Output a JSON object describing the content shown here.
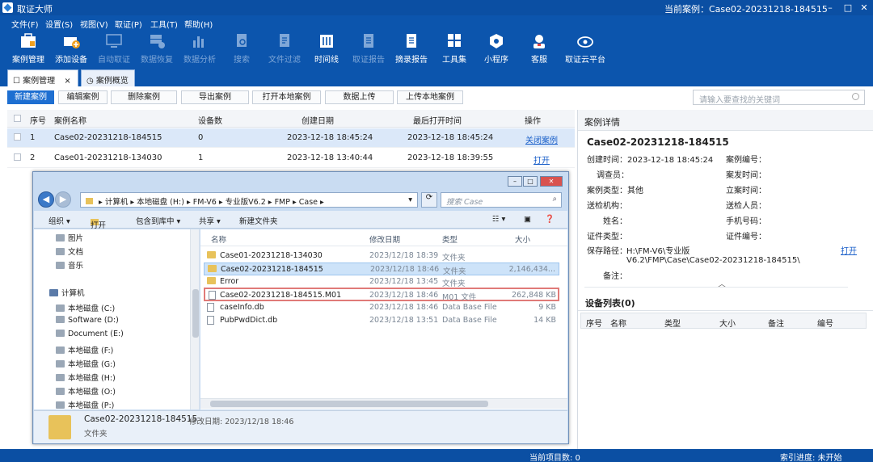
{
  "app": {
    "title": "取证大师",
    "current_case": "当前案例：Case02-20231218-184515"
  },
  "window_buttons": [
    "–",
    "□",
    "✕"
  ],
  "menu": [
    "文件(F)",
    "设置(S)",
    "视图(V)",
    "取证(P)",
    "工具(T)",
    "帮助(H)"
  ],
  "toolbar": [
    {
      "label": "案例管理",
      "icon": "case-manage-icon",
      "enabled": true
    },
    {
      "label": "添加设备",
      "icon": "add-device-icon",
      "enabled": true
    },
    {
      "label": "自动取证",
      "icon": "auto-forensics-icon",
      "enabled": false
    },
    {
      "label": "数据恢复",
      "icon": "data-recovery-icon",
      "enabled": false
    },
    {
      "label": "数据分析",
      "icon": "data-analysis-icon",
      "enabled": false
    },
    {
      "label": "搜索",
      "icon": "search-icon",
      "enabled": false
    },
    {
      "label": "文件过滤",
      "icon": "file-filter-icon",
      "enabled": false
    },
    {
      "label": "时间线",
      "icon": "timeline-icon",
      "enabled": true
    },
    {
      "label": "取证报告",
      "icon": "report-icon",
      "enabled": false
    },
    {
      "label": "摘录报告",
      "icon": "excerpt-report-icon",
      "enabled": true
    },
    {
      "label": "工具集",
      "icon": "toolset-icon",
      "enabled": true
    },
    {
      "label": "小程序",
      "icon": "miniprogram-icon",
      "enabled": true
    },
    {
      "label": "客服",
      "icon": "customer-service-icon",
      "enabled": true
    },
    {
      "label": "取证云平台",
      "icon": "cloud-platform-icon",
      "enabled": true
    }
  ],
  "tabs": [
    {
      "label": "案例管理",
      "close": "×"
    },
    {
      "label": "案例概览"
    }
  ],
  "actions": [
    "新建案例",
    "编辑案例",
    "删除案例",
    "导出案例",
    "打开本地案例",
    "数据上传",
    "上传本地案例"
  ],
  "search": {
    "placeholder": "请输入要查找的关键词"
  },
  "case_table": {
    "headers": [
      "序号",
      "案例名称",
      "设备数",
      "创建日期",
      "最后打开时间",
      "操作"
    ],
    "rows": [
      {
        "no": "1",
        "name": "Case02-20231218-184515",
        "devices": "0",
        "created": "2023-12-18 18:45:24",
        "opened": "2023-12-18 18:45:24",
        "op": "关闭案例"
      },
      {
        "no": "2",
        "name": "Case01-20231218-134030",
        "devices": "1",
        "created": "2023-12-18 13:40:44",
        "opened": "2023-12-18 18:39:55",
        "op": "打开"
      }
    ]
  },
  "detail": {
    "header": "案例详情",
    "case_name": "Case02-20231218-184515",
    "created": "创建时间：2023-12-18 18:45:24",
    "case_no": "案例编号：",
    "investigator": "调查员：",
    "incident_time": "案发时间：",
    "case_type": "案例类型：其他",
    "filing_time": "立案时间：",
    "submit_org": "送检机构：",
    "submitter": "送检人员：",
    "name": "姓名：",
    "phone": "手机号码：",
    "id_type": "证件类型：",
    "id_no": "证件编号：",
    "path_label": "保存路径：",
    "path_value1": "H:\\FM-V6\\专业版",
    "path_value2": "V6.2\\FMP\\Case\\Case02-20231218-184515\\",
    "open_link": "打开",
    "remark": "备注：",
    "collapse": "︿",
    "device_list": "设备列表(0)",
    "device_headers": [
      "序号",
      "名称",
      "类型",
      "大小",
      "备注",
      "编号"
    ]
  },
  "status": {
    "items": "当前项目数: 0",
    "index": "索引进度: 未开始"
  },
  "explorer": {
    "breadcrumb": [
      "计算机",
      "本地磁盘 (H:)",
      "FM-V6",
      "专业版V6.2",
      "FMP",
      "Case"
    ],
    "search_placeholder": "搜索 Case",
    "commands": [
      "组织 ▾",
      "打开",
      "包含到库中 ▾",
      "共享 ▾",
      "新建文件夹"
    ],
    "nav_items": [
      {
        "label": "图片",
        "icon": "pictures-icon"
      },
      {
        "label": "文档",
        "icon": "documents-icon"
      },
      {
        "label": "音乐",
        "icon": "music-icon"
      },
      {
        "label": "计算机",
        "icon": "computer-icon"
      },
      {
        "label": "本地磁盘 (C:)",
        "icon": "drive-icon"
      },
      {
        "label": "Software (D:)",
        "icon": "drive-icon"
      },
      {
        "label": "Document (E:)",
        "icon": "drive-icon"
      },
      {
        "label": "本地磁盘 (F:)",
        "icon": "drive-icon"
      },
      {
        "label": "本地磁盘 (G:)",
        "icon": "drive-icon"
      },
      {
        "label": "本地磁盘 (H:)",
        "icon": "drive-icon"
      },
      {
        "label": "本地磁盘 (O:)",
        "icon": "drive-icon"
      },
      {
        "label": "本地磁盘 (P:)",
        "icon": "drive-icon"
      }
    ],
    "file_headers": [
      "名称",
      "修改日期",
      "类型",
      "大小"
    ],
    "files": [
      {
        "name": "Case01-20231218-134030",
        "date": "2023/12/18 18:39",
        "type": "文件夹",
        "size": "",
        "kind": "folder"
      },
      {
        "name": "Case02-20231218-184515",
        "date": "2023/12/18 18:46",
        "type": "文件夹",
        "size": "2,146,434...",
        "kind": "folder"
      },
      {
        "name": "Error",
        "date": "2023/12/18 13:45",
        "type": "文件夹",
        "size": "",
        "kind": "folder"
      },
      {
        "name": "Case02-20231218-184515.M01",
        "date": "2023/12/18 18:46",
        "type": "M01 文件",
        "size": "262,848 KB",
        "kind": "file"
      },
      {
        "name": "caseInfo.db",
        "date": "2023/12/18 18:46",
        "type": "Data Base File",
        "size": "9 KB",
        "kind": "file"
      },
      {
        "name": "PubPwdDict.db",
        "date": "2023/12/18 13:51",
        "type": "Data Base File",
        "size": "14 KB",
        "kind": "file"
      }
    ],
    "footer": {
      "name": "Case02-20231218-184515",
      "modified": "修改日期: 2023/12/18 18:46",
      "type": "文件夹"
    }
  }
}
